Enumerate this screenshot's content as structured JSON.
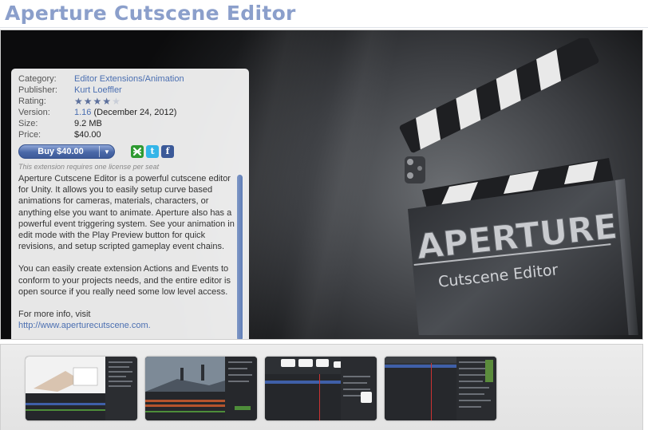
{
  "page": {
    "title": "Aperture Cutscene Editor"
  },
  "meta": {
    "category_label": "Category:",
    "category_value": "Editor Extensions/Animation",
    "publisher_label": "Publisher:",
    "publisher_value": "Kurt Loeffler",
    "rating_label": "Rating:",
    "rating_stars": 4,
    "rating_max": 5,
    "version_label": "Version:",
    "version_number": "1.16",
    "version_date": " (December 24, 2012)",
    "size_label": "Size:",
    "size_value": "9.2 MB",
    "price_label": "Price:",
    "price_value": "$40.00"
  },
  "buy": {
    "label": "Buy $40.00",
    "caret": "▼"
  },
  "share": {
    "icons": [
      "share-icon",
      "twitter-icon",
      "facebook-icon"
    ],
    "twitter_glyph": "t",
    "facebook_glyph": "f"
  },
  "license_note": "This extension requires one license per seat",
  "description": {
    "paragraph1": "Aperture Cutscene Editor is a powerful cutscene editor for Unity. It allows you to easily setup curve based animations for cameras, materials, characters, or anything else you want to animate. Aperture also has a powerful event triggering system. See your animation in edit mode with the Play Preview button for quick revisions, and setup scripted gameplay event chains.",
    "paragraph2": "You can easily create extension Actions and Events to conform to your projects needs, and the entire editor is open source if you really need some low level access.",
    "more_info": "For more info, visit",
    "url": "http://www.aperturecutscene.com."
  },
  "hero_image": {
    "logo_main": "APERTURE",
    "logo_sub": "Cutscene Editor"
  },
  "colors": {
    "title": "#8b9fcb",
    "link": "#4b6fb1",
    "button": "#4a68a8"
  }
}
